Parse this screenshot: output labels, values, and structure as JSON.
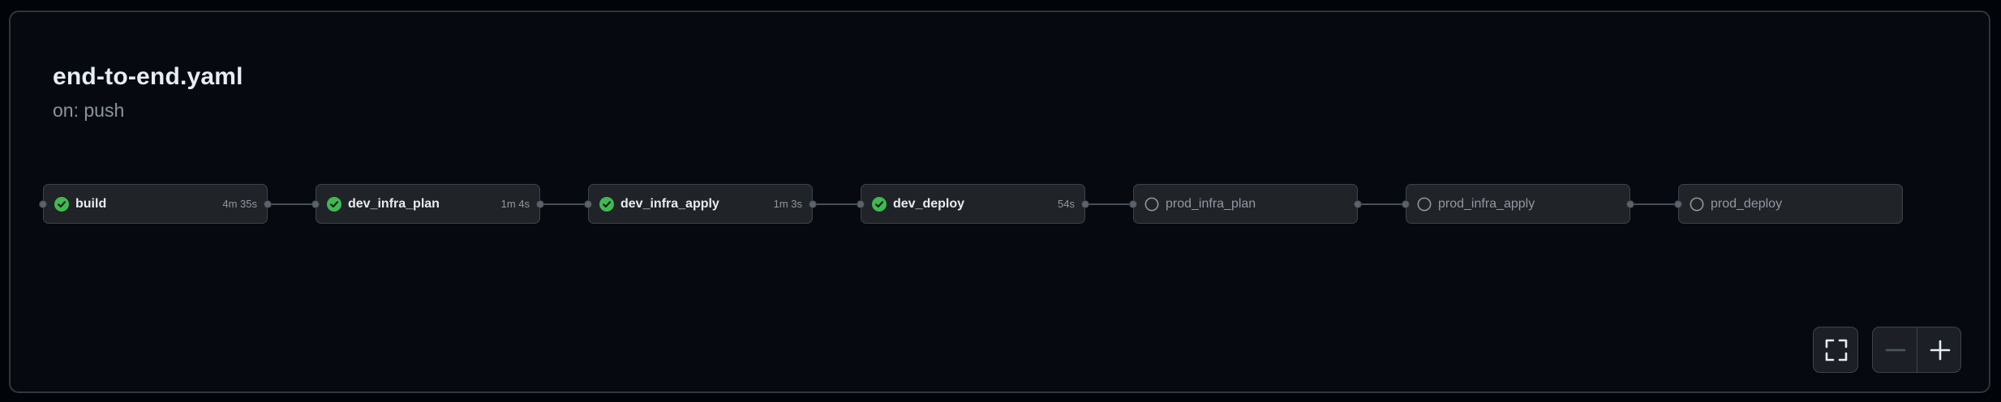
{
  "workflow": {
    "title": "end-to-end.yaml",
    "trigger": "on: push"
  },
  "jobs": [
    {
      "name": "build",
      "duration": "4m 35s",
      "status": "success"
    },
    {
      "name": "dev_infra_plan",
      "duration": "1m 4s",
      "status": "success"
    },
    {
      "name": "dev_infra_apply",
      "duration": "1m 3s",
      "status": "success"
    },
    {
      "name": "dev_deploy",
      "duration": "54s",
      "status": "success"
    },
    {
      "name": "prod_infra_plan",
      "duration": "",
      "status": "pending"
    },
    {
      "name": "prod_infra_apply",
      "duration": "",
      "status": "pending"
    },
    {
      "name": "prod_deploy",
      "duration": "",
      "status": "pending"
    }
  ],
  "controls": {
    "fullscreen_icon": "fullscreen-icon",
    "zoom_out_icon": "minus-icon",
    "zoom_in_icon": "plus-icon"
  },
  "colors": {
    "success": "#3fb950",
    "pending_ring": "#9198a1",
    "background": "#060a10",
    "card": "#202328",
    "border": "#3d444d"
  }
}
